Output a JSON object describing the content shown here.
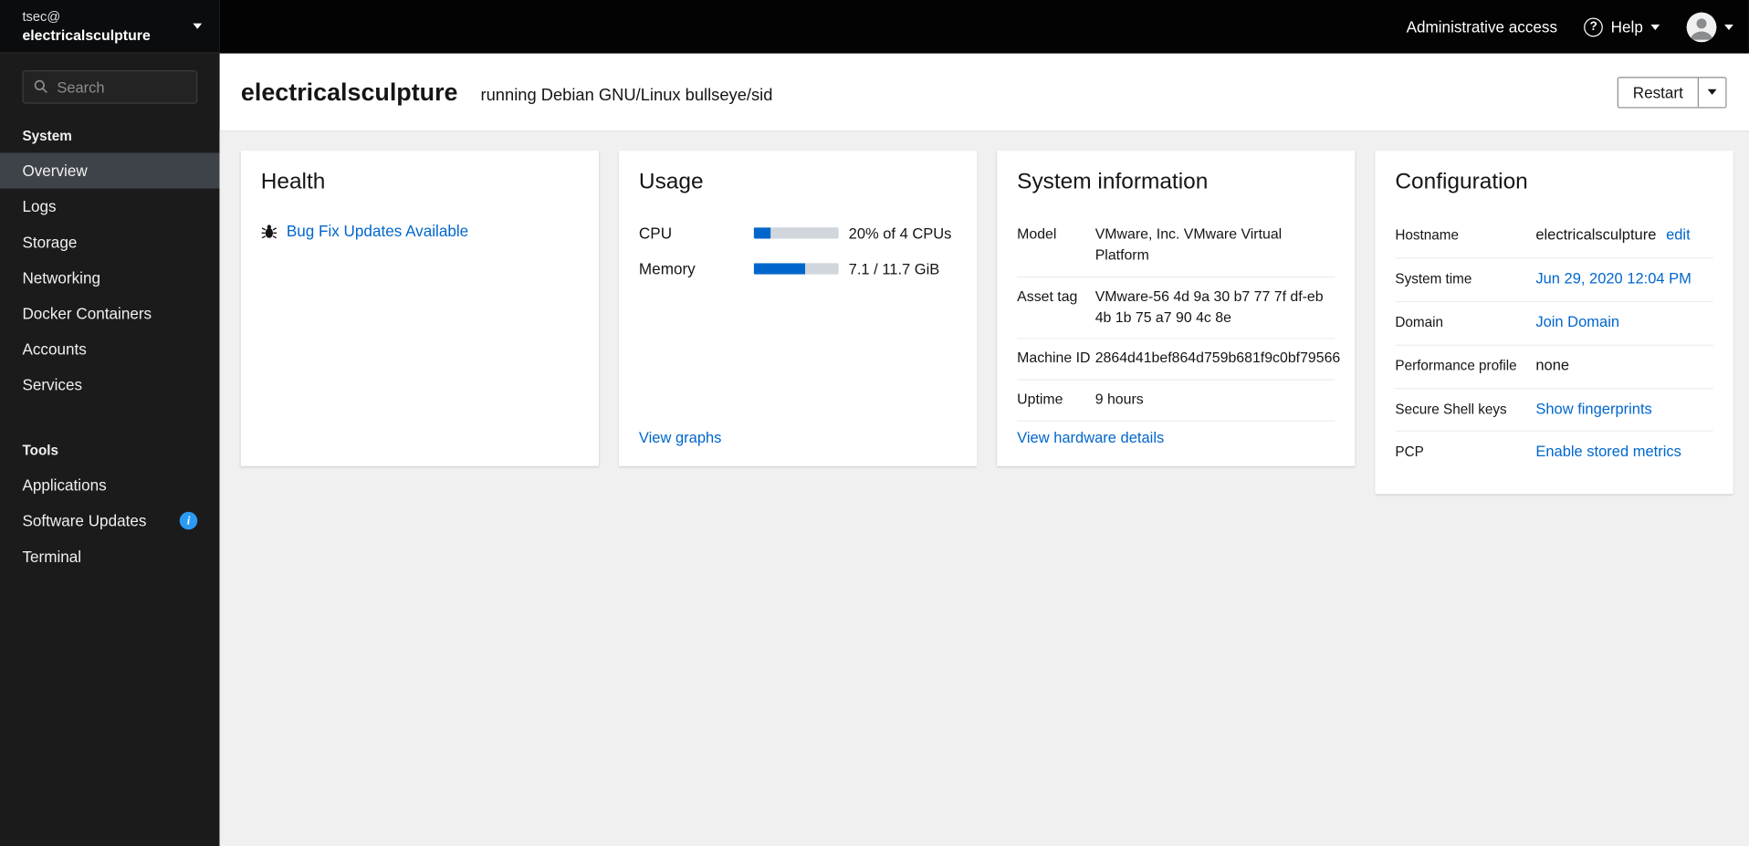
{
  "masthead": {
    "host_user": "tsec@",
    "host_name": "electricalsculpture",
    "admin_access_label": "Administrative access",
    "help_label": "Help"
  },
  "icons": {
    "help_glyph": "?",
    "info_badge_glyph": "i"
  },
  "sidebar": {
    "search_placeholder": "Search",
    "system_header": "System",
    "tools_header": "Tools",
    "system_items": [
      {
        "label": "Overview",
        "active": true
      },
      {
        "label": "Logs"
      },
      {
        "label": "Storage"
      },
      {
        "label": "Networking"
      },
      {
        "label": "Docker Containers"
      },
      {
        "label": "Accounts"
      },
      {
        "label": "Services"
      }
    ],
    "tools_items": [
      {
        "label": "Applications"
      },
      {
        "label": "Software Updates",
        "badge": "info"
      },
      {
        "label": "Terminal"
      }
    ]
  },
  "header": {
    "hostname": "electricalsculpture",
    "os_text": "running Debian GNU/Linux bullseye/sid",
    "restart_label": "Restart"
  },
  "cards": {
    "health": {
      "title": "Health",
      "update_link": "Bug Fix Updates Available"
    },
    "usage": {
      "title": "Usage",
      "rows": [
        {
          "label": "CPU",
          "percent": 20,
          "value": "20% of 4 CPUs"
        },
        {
          "label": "Memory",
          "percent": 61,
          "value": "7.1 / 11.7 GiB"
        }
      ],
      "view_graphs_link": "View graphs"
    },
    "system_information": {
      "title": "System information",
      "rows": [
        {
          "label": "Model",
          "value": "VMware, Inc. VMware Virtual Platform"
        },
        {
          "label": "Asset tag",
          "value": "VMware-56 4d 9a 30 b7 77 7f df-eb 4b 1b 75 a7 90 4c 8e"
        },
        {
          "label": "Machine ID",
          "value": "2864d41bef864d759b681f9c0bf79566"
        },
        {
          "label": "Uptime",
          "value": "9 hours"
        }
      ],
      "details_link": "View hardware details"
    },
    "configuration": {
      "title": "Configuration",
      "rows": [
        {
          "label": "Hostname",
          "value": "electricalsculpture",
          "action": "edit"
        },
        {
          "label": "System time",
          "link": "Jun 29, 2020 12:04 PM"
        },
        {
          "label": "Domain",
          "link": "Join Domain"
        },
        {
          "label": "Performance profile",
          "value": "none"
        },
        {
          "label": "Secure Shell keys",
          "link": "Show fingerprints"
        },
        {
          "label": "PCP",
          "link": "Enable stored metrics"
        }
      ]
    }
  },
  "colors": {
    "link_accent": "#0066cc",
    "progress_fill": "#0066cc",
    "masthead_bg": "#030303",
    "sidebar_bg": "#1b1b1b",
    "page_bg": "#f0f0f0",
    "info_badge": "#2b9af3",
    "nav_current_bg": "#3e4349"
  }
}
